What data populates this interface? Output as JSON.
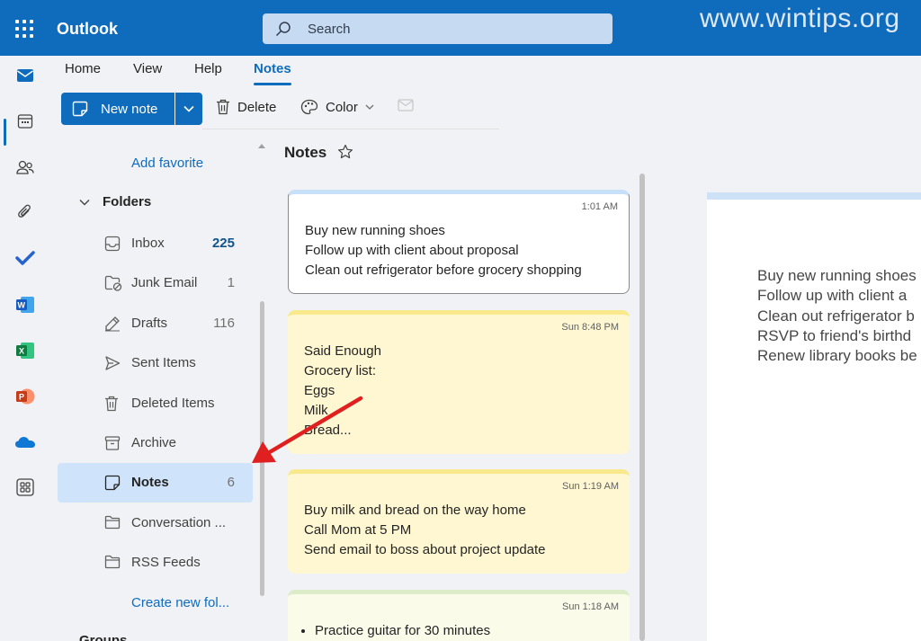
{
  "header": {
    "app_name": "Outlook",
    "search_placeholder": "Search",
    "watermark": "www.wintips.org"
  },
  "rail": {
    "items": [
      "mail-icon",
      "calendar-icon",
      "people-icon",
      "attachment-icon",
      "todo-icon",
      "word-icon",
      "excel-icon",
      "powerpoint-icon",
      "onedrive-icon",
      "apps-icon"
    ]
  },
  "ribbon": {
    "tabs": [
      "Home",
      "View",
      "Help",
      "Notes"
    ],
    "active_tab": "Notes",
    "new_note": "New note",
    "delete": "Delete",
    "color": "Color"
  },
  "folder_pane": {
    "add_favorite": "Add favorite",
    "folders_header": "Folders",
    "folders": [
      {
        "name": "Inbox",
        "count": "225"
      },
      {
        "name": "Junk Email",
        "count": "1"
      },
      {
        "name": "Drafts",
        "count": "116"
      },
      {
        "name": "Sent Items",
        "count": ""
      },
      {
        "name": "Deleted Items",
        "count": ""
      },
      {
        "name": "Archive",
        "count": ""
      },
      {
        "name": "Notes",
        "count": "6"
      },
      {
        "name": "Conversation ...",
        "count": ""
      },
      {
        "name": "RSS Feeds",
        "count": ""
      }
    ],
    "selected_folder": "Notes",
    "create_new_folder": "Create new fol...",
    "groups_header": "Groups"
  },
  "notes_list": {
    "title": "Notes",
    "notes": [
      {
        "time": "1:01 AM",
        "color": "#c7dff7",
        "lines": [
          "Buy new running shoes",
          "Follow up with client about proposal",
          "Clean out refrigerator before grocery shopping"
        ]
      },
      {
        "time": "Sun 8:48 PM",
        "color": "#f9e98d",
        "lines": [
          "Said Enough",
          "Grocery list:",
          "Eggs",
          "Milk",
          "Bread..."
        ]
      },
      {
        "time": "Sun 1:19 AM",
        "color": "#f9e98d",
        "lines": [
          "Buy milk and bread on the way home",
          "Call Mom at 5 PM",
          "Send email to boss about project update"
        ]
      },
      {
        "time": "Sun 1:18 AM",
        "color": "#dcecc8",
        "lines": [
          "Practice guitar for 30 minutes"
        ]
      }
    ]
  },
  "reading_pane": {
    "lines": [
      "Buy new running shoes",
      "Follow up with client a",
      "Clean out refrigerator b",
      "RSVP to friend's birthd",
      "Renew library books be"
    ]
  },
  "colors": {
    "accent": "#0f6cbd",
    "selected_bg": "#cfe4fa",
    "annotation_arrow": "#e02020"
  }
}
